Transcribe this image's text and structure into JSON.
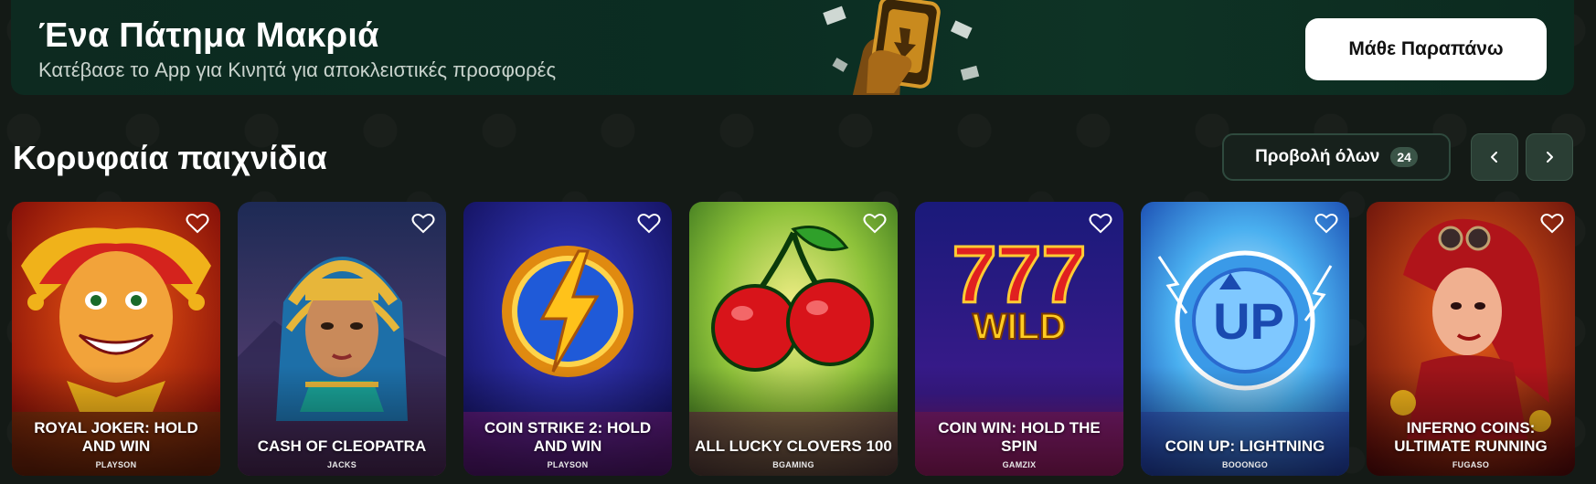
{
  "banner": {
    "title": "Ένα Πάτημα Μακριά",
    "subtitle": "Κατέβασε το App για Κινητά για αποκλειστικές προσφορές",
    "button_label": "Μάθε Παραπάνω"
  },
  "section": {
    "title": "Κορυφαία παιχνίδια",
    "view_all_label": "Προβολή όλων",
    "view_all_count": "24"
  },
  "games": [
    {
      "name": "ROYAL JOKER: HOLD AND WIN",
      "provider": "PLAYSON"
    },
    {
      "name": "CASH OF CLEOPATRA",
      "provider": "JACKS"
    },
    {
      "name": "COIN STRIKE 2: HOLD AND WIN",
      "provider": "PLAYSON"
    },
    {
      "name": "ALL LUCKY CLOVERS 100",
      "provider": "BGAMING"
    },
    {
      "name": "COIN WIN: HOLD THE SPIN",
      "provider": "GAMZIX"
    },
    {
      "name": "COIN UP: LIGHTNING",
      "provider": "BOOONGO"
    },
    {
      "name": "INFERNO COINS: ULTIMATE RUNNING",
      "provider": "FUGASO"
    }
  ],
  "icons": {
    "favorite": "heart-icon",
    "prev": "chevron-left-icon",
    "next": "chevron-right-icon"
  },
  "colors": {
    "page_bg": "#141a16",
    "banner_bg": "#0b2d22",
    "button_bg": "#ffffff",
    "nav_bg": "#2a3e34"
  }
}
